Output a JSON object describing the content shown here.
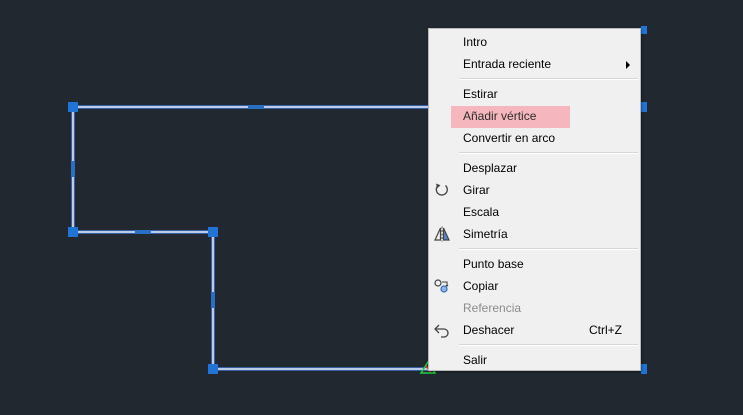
{
  "menu": {
    "items": [
      {
        "label": "Intro"
      },
      {
        "label": "Entrada reciente"
      },
      {
        "label": "Estirar"
      },
      {
        "label": "Añadir vértice"
      },
      {
        "label": "Convertir en arco"
      },
      {
        "label": "Desplazar"
      },
      {
        "label": "Girar",
        "icon": "rotate-icon"
      },
      {
        "label": "Escala"
      },
      {
        "label": "Simetría",
        "icon": "mirror-icon"
      },
      {
        "label": "Punto base"
      },
      {
        "label": "Copiar",
        "icon": "copy-icon"
      },
      {
        "label": "Referencia"
      },
      {
        "label": "Deshacer",
        "icon": "undo-icon",
        "shortcut": "Ctrl+Z"
      },
      {
        "label": "Salir"
      }
    ]
  },
  "colors": {
    "canvas_background": "#212830",
    "polyline": "#e8f0ff",
    "polyline_glow": "#4a8cff",
    "grip": "#1f74d6",
    "menu_background": "#f0f0f0",
    "menu_highlight": "#f5b7bd",
    "ucs_icon": "#1fcf3a"
  }
}
